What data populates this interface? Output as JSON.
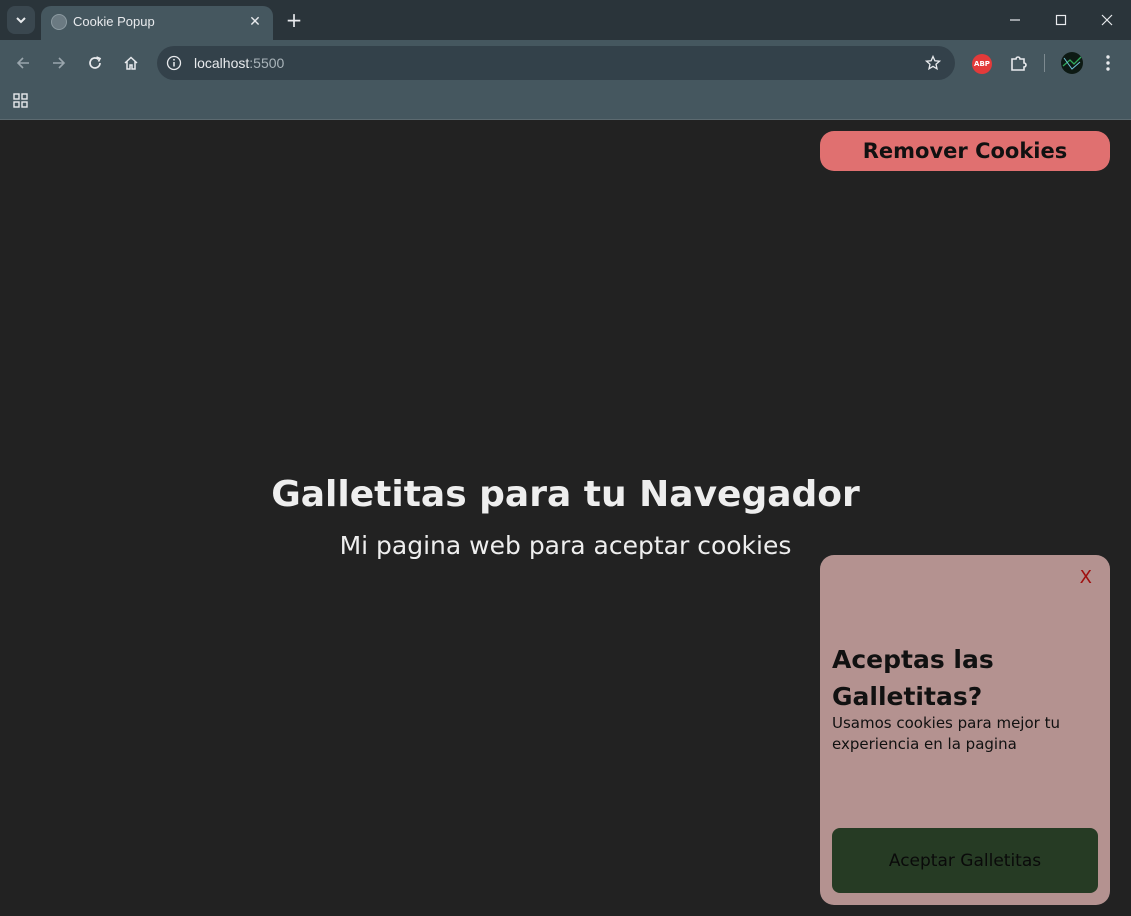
{
  "browser": {
    "tab": {
      "title": "Cookie Popup",
      "close": "✕"
    },
    "new_tab": "+",
    "url": {
      "host": "localhost",
      "port": ":5500"
    },
    "extension_abp": "ABP",
    "icons": {
      "tab_list": "chevron-down-icon",
      "favicon": "globe-icon",
      "back": "arrow-left-icon",
      "forward": "arrow-right-icon",
      "reload": "reload-icon",
      "home": "home-icon",
      "site_info": "info-icon",
      "bookmark": "star-icon",
      "extensions": "puzzle-icon",
      "menu": "kebab-menu-icon",
      "apps": "apps-grid-icon",
      "minimize": "minimize-icon",
      "maximize": "maximize-icon",
      "close": "close-icon"
    }
  },
  "page": {
    "remove_button": "Remover Cookies",
    "title": "Galletitas para tu Navegador",
    "subtitle": "Mi pagina web para aceptar cookies",
    "popup": {
      "close": "X",
      "title": "Aceptas las Galletitas?",
      "text": "Usamos cookies para mejor tu experiencia en la pagina",
      "accept_button": "Aceptar Galletitas"
    }
  },
  "colors": {
    "page_bg": "#222222",
    "remove_button_bg": "#e07070",
    "popup_bg": "#b49290",
    "accept_button_bg": "#263b24",
    "popup_close": "#a01010"
  }
}
